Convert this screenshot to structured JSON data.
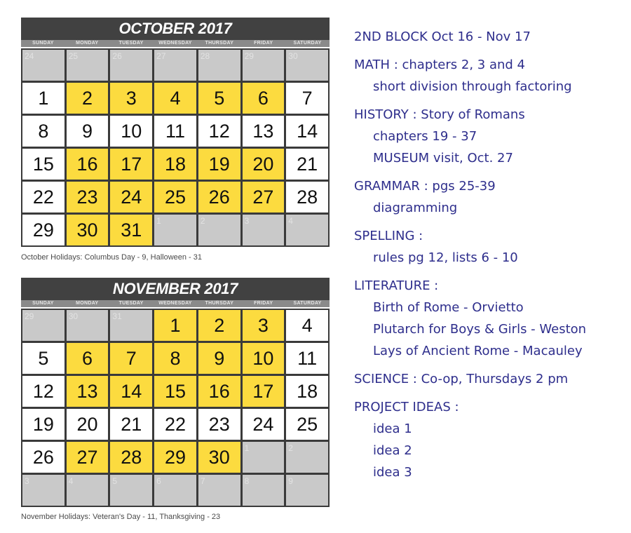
{
  "calendars": [
    {
      "title": "OCTOBER 2017",
      "weekdays": [
        "SUNDAY",
        "MONDAY",
        "TUESDAY",
        "WEDNESDAY",
        "THURSDAY",
        "FRIDAY",
        "SATURDAY"
      ],
      "cells": [
        {
          "d": "24",
          "t": "out"
        },
        {
          "d": "25",
          "t": "out"
        },
        {
          "d": "26",
          "t": "out"
        },
        {
          "d": "27",
          "t": "out"
        },
        {
          "d": "28",
          "t": "out"
        },
        {
          "d": "29",
          "t": "out"
        },
        {
          "d": "30",
          "t": "out"
        },
        {
          "d": "1",
          "t": "in"
        },
        {
          "d": "2",
          "t": "hl"
        },
        {
          "d": "3",
          "t": "hl"
        },
        {
          "d": "4",
          "t": "hl"
        },
        {
          "d": "5",
          "t": "hl"
        },
        {
          "d": "6",
          "t": "hl"
        },
        {
          "d": "7",
          "t": "in"
        },
        {
          "d": "8",
          "t": "in"
        },
        {
          "d": "9",
          "t": "in"
        },
        {
          "d": "10",
          "t": "in"
        },
        {
          "d": "11",
          "t": "in"
        },
        {
          "d": "12",
          "t": "in"
        },
        {
          "d": "13",
          "t": "in"
        },
        {
          "d": "14",
          "t": "in"
        },
        {
          "d": "15",
          "t": "in"
        },
        {
          "d": "16",
          "t": "hl"
        },
        {
          "d": "17",
          "t": "hl"
        },
        {
          "d": "18",
          "t": "hl"
        },
        {
          "d": "19",
          "t": "hl"
        },
        {
          "d": "20",
          "t": "hl"
        },
        {
          "d": "21",
          "t": "in"
        },
        {
          "d": "22",
          "t": "in"
        },
        {
          "d": "23",
          "t": "hl"
        },
        {
          "d": "24",
          "t": "hl"
        },
        {
          "d": "25",
          "t": "hl"
        },
        {
          "d": "26",
          "t": "hl"
        },
        {
          "d": "27",
          "t": "hl"
        },
        {
          "d": "28",
          "t": "in"
        },
        {
          "d": "29",
          "t": "in"
        },
        {
          "d": "30",
          "t": "hl"
        },
        {
          "d": "31",
          "t": "hl"
        },
        {
          "d": "1",
          "t": "out"
        },
        {
          "d": "2",
          "t": "out"
        },
        {
          "d": "3",
          "t": "out"
        },
        {
          "d": "4",
          "t": "out"
        }
      ],
      "caption": "October  Holidays: Columbus Day - 9,  Halloween - 31"
    },
    {
      "title": "NOVEMBER 2017",
      "weekdays": [
        "SUNDAY",
        "MONDAY",
        "TUESDAY",
        "WEDNESDAY",
        "THURSDAY",
        "FRIDAY",
        "SATURDAY"
      ],
      "cells": [
        {
          "d": "29",
          "t": "out"
        },
        {
          "d": "30",
          "t": "out"
        },
        {
          "d": "31",
          "t": "out"
        },
        {
          "d": "1",
          "t": "hl"
        },
        {
          "d": "2",
          "t": "hl"
        },
        {
          "d": "3",
          "t": "hl"
        },
        {
          "d": "4",
          "t": "in"
        },
        {
          "d": "5",
          "t": "in"
        },
        {
          "d": "6",
          "t": "hl"
        },
        {
          "d": "7",
          "t": "hl"
        },
        {
          "d": "8",
          "t": "hl"
        },
        {
          "d": "9",
          "t": "hl"
        },
        {
          "d": "10",
          "t": "hl"
        },
        {
          "d": "11",
          "t": "in"
        },
        {
          "d": "12",
          "t": "in"
        },
        {
          "d": "13",
          "t": "hl"
        },
        {
          "d": "14",
          "t": "hl"
        },
        {
          "d": "15",
          "t": "hl"
        },
        {
          "d": "16",
          "t": "hl"
        },
        {
          "d": "17",
          "t": "hl"
        },
        {
          "d": "18",
          "t": "in"
        },
        {
          "d": "19",
          "t": "in"
        },
        {
          "d": "20",
          "t": "in"
        },
        {
          "d": "21",
          "t": "in"
        },
        {
          "d": "22",
          "t": "in"
        },
        {
          "d": "23",
          "t": "in"
        },
        {
          "d": "24",
          "t": "in"
        },
        {
          "d": "25",
          "t": "in"
        },
        {
          "d": "26",
          "t": "in"
        },
        {
          "d": "27",
          "t": "hl"
        },
        {
          "d": "28",
          "t": "hl"
        },
        {
          "d": "29",
          "t": "hl"
        },
        {
          "d": "30",
          "t": "hl"
        },
        {
          "d": "1",
          "t": "out"
        },
        {
          "d": "2",
          "t": "out"
        },
        {
          "d": "3",
          "t": "out"
        },
        {
          "d": "4",
          "t": "out"
        },
        {
          "d": "5",
          "t": "out"
        },
        {
          "d": "6",
          "t": "out"
        },
        {
          "d": "7",
          "t": "out"
        },
        {
          "d": "8",
          "t": "out"
        },
        {
          "d": "9",
          "t": "out"
        }
      ],
      "caption": "November Holidays: Veteran's Day - 11, Thanksgiving - 23"
    }
  ],
  "colors": {
    "highlight": "#fcdb3f",
    "title_bar": "#414141",
    "out_of_month": "#c9c9c9",
    "notes_text": "#2e2e8c"
  },
  "notes": {
    "block": "2ND BLOCK Oct 16 - Nov 17",
    "sections": [
      {
        "head": "MATH : chapters 2, 3 and 4",
        "items": [
          "short division through factoring"
        ]
      },
      {
        "head": "HISTORY : Story of Romans",
        "items": [
          "chapters 19 - 37",
          "MUSEUM visit, Oct. 27"
        ]
      },
      {
        "head": "GRAMMAR : pgs 25-39",
        "items": [
          "diagramming"
        ]
      },
      {
        "head": "SPELLING :",
        "items": [
          "rules pg 12, lists 6 - 10"
        ]
      },
      {
        "head": "LITERATURE :",
        "items": [
          "Birth of Rome - Orvietto",
          "Plutarch for Boys & Girls - Weston",
          "Lays of Ancient Rome - Macauley"
        ]
      },
      {
        "head": "SCIENCE : Co-op, Thursdays 2 pm",
        "items": []
      },
      {
        "head": "PROJECT IDEAS :",
        "items": [
          "idea 1",
          "idea 2",
          "idea 3"
        ]
      }
    ]
  }
}
